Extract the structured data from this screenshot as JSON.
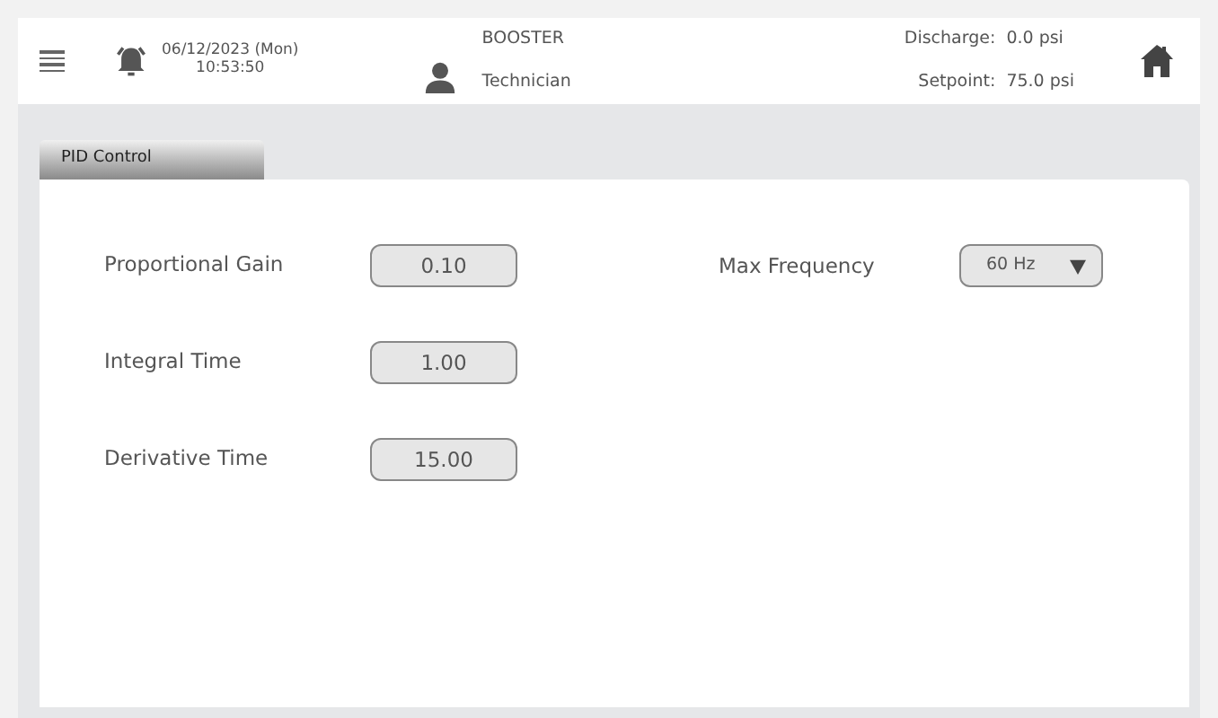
{
  "header": {
    "date": "06/12/2023 (Mon)",
    "time": "10:53:50",
    "station": "BOOSTER",
    "user": "Technician",
    "readings": [
      {
        "label": "Discharge:",
        "value": "0.0 psi"
      },
      {
        "label": "Setpoint:",
        "value": "75.0 psi"
      }
    ]
  },
  "tabs": [
    {
      "label": "PID Control",
      "selected": true
    }
  ],
  "fields": [
    {
      "label": "Proportional Gain",
      "value": "0.10"
    },
    {
      "label": "Integral Time",
      "value": "1.00"
    },
    {
      "label": "Derivative Time",
      "value": "15.00"
    }
  ],
  "max_frequency": {
    "label": "Max Frequency",
    "value": "60 Hz"
  }
}
